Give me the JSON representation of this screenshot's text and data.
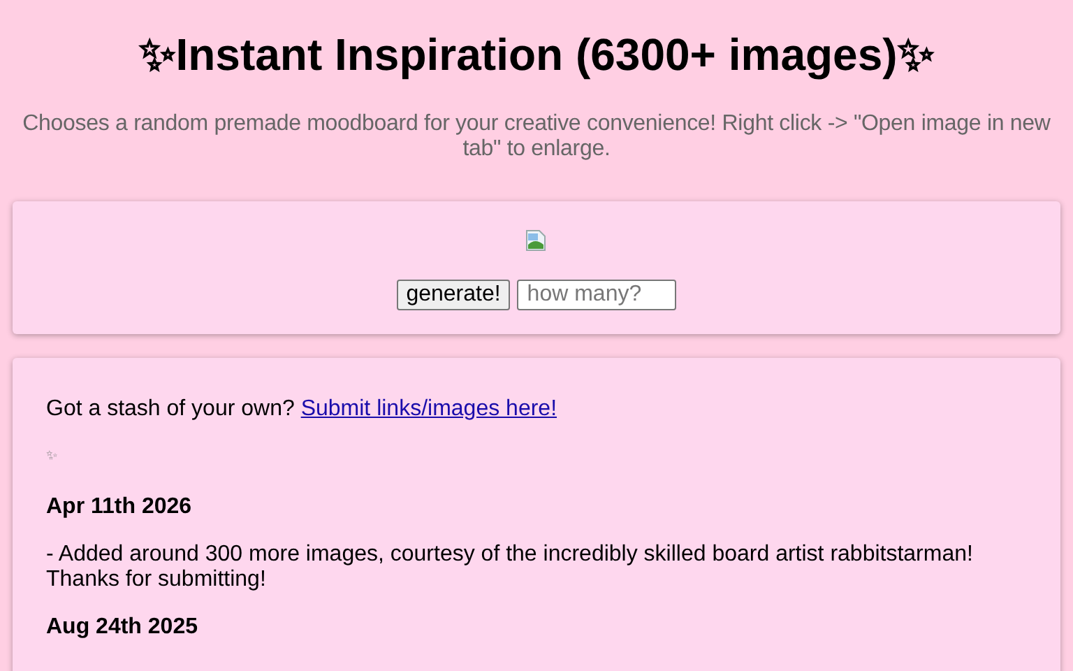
{
  "title": {
    "sparkle_left": "✨",
    "text": "Instant Inspiration (6300+ images)",
    "sparkle_right": "✨"
  },
  "subtitle": "Chooses a random premade moodboard for your creative convenience! Right click -> \"Open image in new tab\" to enlarge.",
  "generator": {
    "image": {
      "kind": "broken-image"
    },
    "button": "generate!",
    "count_field": {
      "placeholder": "how many?"
    }
  },
  "updates": {
    "intro": "Got a stash of your own?",
    "link": "Submit links/images here!",
    "divider": "✨",
    "entries": [
      {
        "date": "Apr 11th 2026",
        "text": "- Added around 300 more images, courtesy of the incredibly skilled board artist rabbitstarman! Thanks for submitting!"
      },
      {
        "date": "Aug 24th 2025"
      }
    ]
  }
}
